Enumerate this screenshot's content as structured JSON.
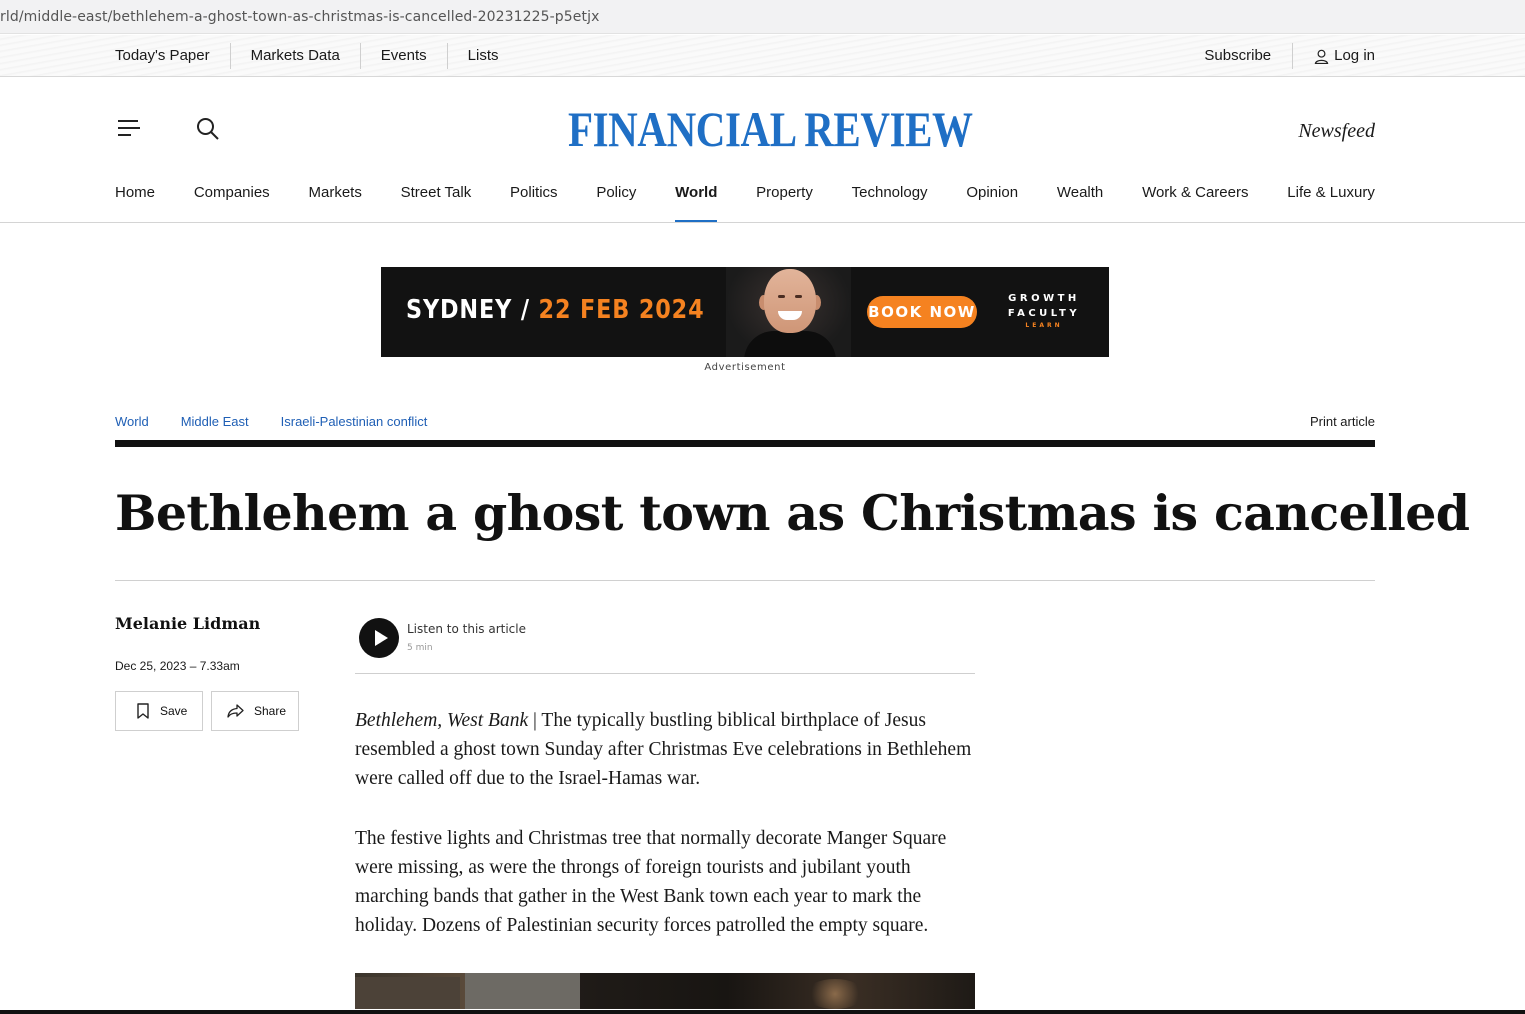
{
  "browser": {
    "url": "rld/middle-east/bethlehem-a-ghost-town-as-christmas-is-cancelled-20231225-p5etjx"
  },
  "utility_bar": {
    "left_links": [
      "Today's Paper",
      "Markets Data",
      "Events",
      "Lists"
    ],
    "subscribe": "Subscribe",
    "login": "Log in"
  },
  "masthead": {
    "logo": "FINANCIAL REVIEW",
    "newsfeed": "Newsfeed",
    "menu_icon": "hamburger-icon",
    "search_icon": "search-icon"
  },
  "nav": {
    "items": [
      "Home",
      "Companies",
      "Markets",
      "Street Talk",
      "Politics",
      "Policy",
      "World",
      "Property",
      "Technology",
      "Opinion",
      "Wealth",
      "Work & Careers",
      "Life & Luxury"
    ],
    "active": "World"
  },
  "ad": {
    "city": "SYDNEY /",
    "date": "22 FEB 2024",
    "cta": "BOOK NOW",
    "brand_line1": "GROWTH",
    "brand_line2": "FACULTY",
    "brand_line3": "LEARN",
    "label": "Advertisement"
  },
  "article": {
    "breadcrumbs": [
      "World",
      "Middle East",
      "Israeli-Palestinian conflict"
    ],
    "print": "Print article",
    "headline": "Bethlehem a ghost town as Christmas is cancelled",
    "author": "Melanie Lidman",
    "date": "Dec 25, 2023 – 7.33am",
    "save": "Save",
    "share": "Share",
    "listen": "Listen to this article",
    "listen_duration": "5 min",
    "dateline": "Bethlehem, West Bank",
    "separator": " | ",
    "para1": "The typically bustling biblical birthplace of Jesus resembled a ghost town Sunday after Christmas Eve celebrations in Bethlehem were called off due to the Israel-Hamas war.",
    "para2": "The festive lights and Christmas tree that normally decorate Manger Square were missing, as were the throngs of foreign tourists and jubilant youth marching bands that gather in the West Bank town each year to mark the holiday. Dozens of Palestinian security forces patrolled the empty square."
  },
  "colors": {
    "brand_blue": "#1f6fc5",
    "link_blue": "#1f5fb5",
    "ad_orange": "#f58220",
    "ad_background": "#121212"
  }
}
